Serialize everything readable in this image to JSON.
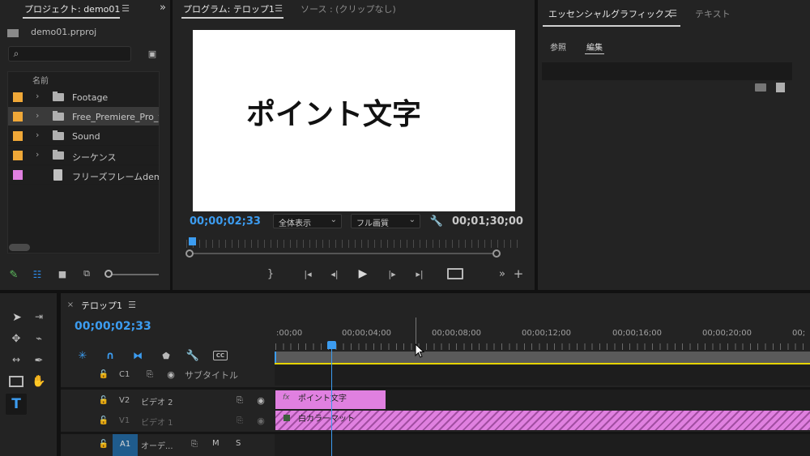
{
  "project": {
    "tab_label": "プロジェクト: demo01",
    "file_name": "demo01.prproj",
    "column_name": "名前",
    "items": [
      {
        "label": "Footage",
        "color": "#f0a838",
        "type": "folder"
      },
      {
        "label": "Free_Premiere_Pro_t",
        "color": "#f0a838",
        "type": "folder"
      },
      {
        "label": "Sound",
        "color": "#f0a838",
        "type": "folder"
      },
      {
        "label": "シーケンス",
        "color": "#f0a838",
        "type": "folder"
      },
      {
        "label": "フリーズフレームdemo",
        "color": "#e080e0",
        "type": "file"
      }
    ]
  },
  "program": {
    "tab_label": "プログラム: テロップ1",
    "source_tab": "ソース : (クリップなし)",
    "preview_text": "ポイント文字",
    "current_time": "00;00;02;33",
    "zoom_select": "全体表示",
    "quality_select": "フル画質",
    "duration": "00;01;30;00"
  },
  "essential": {
    "tab_label": "エッセンシャルグラフィックス",
    "text_tab": "テキスト",
    "browse_tab": "参照",
    "edit_tab": "編集"
  },
  "timeline": {
    "sequence_tab": "テロップ1",
    "timecode": "00;00;02;33",
    "ruler_labels": [
      ":00;00",
      "00;00;04;00",
      "00;00;08;00",
      "00;00;12;00",
      "00;00;16;00",
      "00;00;20;00",
      "00;"
    ],
    "tracks": {
      "c1": {
        "name": "C1",
        "label": "サブタイトル"
      },
      "v2": {
        "name": "V2",
        "label": "ビデオ 2"
      },
      "v1": {
        "name": "V1",
        "label": "ビデオ 1"
      },
      "a1": {
        "name": "A1",
        "label": "オーデ...",
        "m": "M",
        "s": "S"
      }
    },
    "clips": {
      "v2": {
        "fx": "fx",
        "label": "ポイント文字"
      },
      "v1": {
        "label": "白カラーマット"
      }
    },
    "accent": "#2d8ceb",
    "clip_color": "#e080e0"
  }
}
